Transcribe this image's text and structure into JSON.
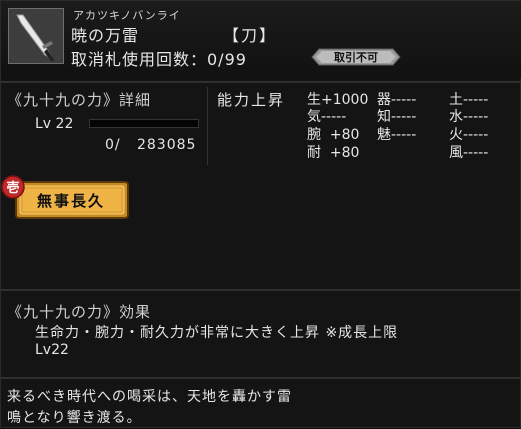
{
  "item": {
    "ruby": "アカツキノバンライ",
    "name": "暁の万雷",
    "type": "【刀】",
    "cancel_label": "取消札使用回数：0/99",
    "badge": "取引不可"
  },
  "skill": {
    "title": "《九十九の力》詳細",
    "level": "Lv 22",
    "exp_current": "0/",
    "exp_needed": "283085",
    "exp_fraction": 0
  },
  "ability": {
    "title": "能力上昇",
    "stats": [
      [
        "生+1000",
        "器-----",
        "土-----"
      ],
      [
        "気-----",
        "知-----",
        "水-----"
      ],
      [
        "腕  +80",
        "魅-----",
        "火-----"
      ],
      [
        "耐  +80",
        "",
        "風-----"
      ]
    ]
  },
  "special": {
    "label": "無事長久",
    "marker": "壱",
    "marker_color": "#c0282a",
    "plate_color": "#e0a030"
  },
  "effect": {
    "title": "《九十九の力》効果",
    "text": "生命力・腕力・耐久力が非常に大きく上昇 ※成長上限",
    "level": "Lv22"
  },
  "flavor": {
    "line1": "来るべき時代への喝采は、天地を轟かす雷",
    "line2": "鳴となり響き渡る。"
  }
}
